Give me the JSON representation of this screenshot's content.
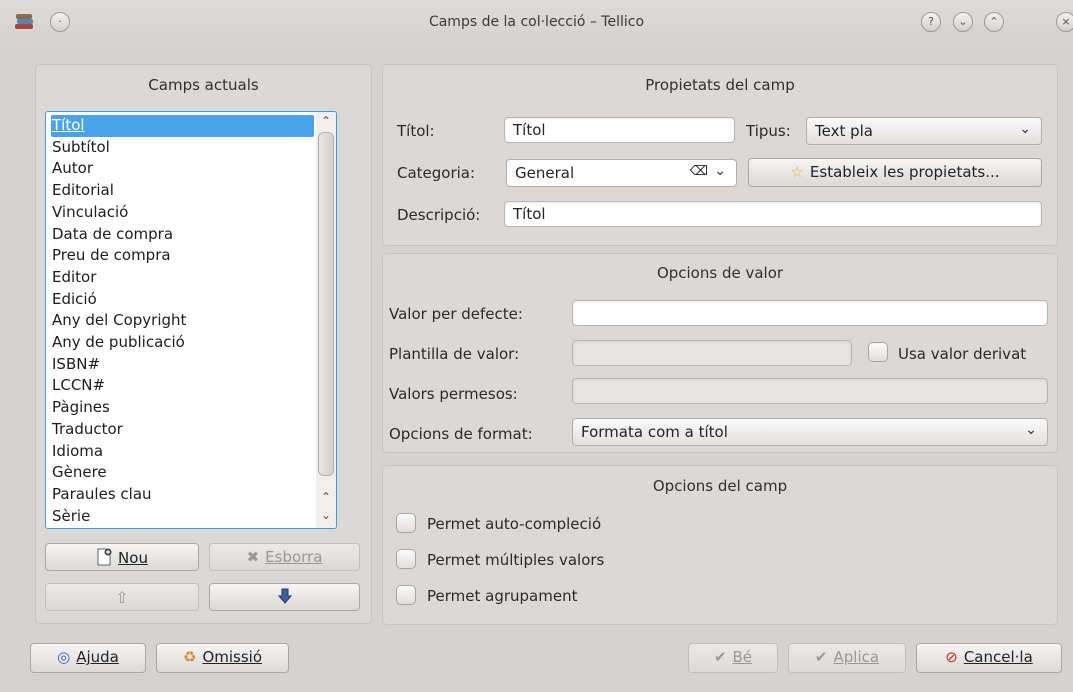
{
  "window": {
    "title": "Camps de la col·lecció – Tellico"
  },
  "left_panel": {
    "title": "Camps actuals",
    "fields": [
      "Títol",
      "Subtítol",
      "Autor",
      "Editorial",
      "Vinculació",
      "Data de compra",
      "Preu de compra",
      "Editor",
      "Edició",
      "Any del Copyright",
      "Any de publicació",
      "ISBN#",
      "LCCN#",
      "Pàgines",
      "Traductor",
      "Idioma",
      "Gènere",
      "Paraules clau",
      "Sèrie"
    ],
    "selected_index": 0,
    "new_label": "Nou",
    "delete_label": "Esborra"
  },
  "field_props": {
    "title": "Propietats del camp",
    "title_label": "Títol:",
    "title_value": "Títol",
    "type_label": "Tipus:",
    "type_value": "Text pla",
    "category_label": "Categoria:",
    "category_value": "General",
    "set_props_label": "Estableix les propietats...",
    "description_label": "Descripció:",
    "description_value": "Títol"
  },
  "value_options": {
    "title": "Opcions de valor",
    "default_label": "Valor per defecte:",
    "default_value": "",
    "template_label": "Plantilla de valor:",
    "template_value": "",
    "derived_label": "Usa valor derivat",
    "allowed_label": "Valors permesos:",
    "allowed_value": "",
    "format_label": "Opcions de format:",
    "format_value": "Formata com a títol"
  },
  "field_options": {
    "title": "Opcions del camp",
    "autocomplete_label": "Permet auto-compleció",
    "multiple_label": "Permet múltiples valors",
    "grouping_label": "Permet agrupament"
  },
  "footer": {
    "help_label": "Ajuda",
    "default_label": "Omissió",
    "ok_label": "Bé",
    "apply_label": "Aplica",
    "cancel_label": "Cancel·la"
  }
}
